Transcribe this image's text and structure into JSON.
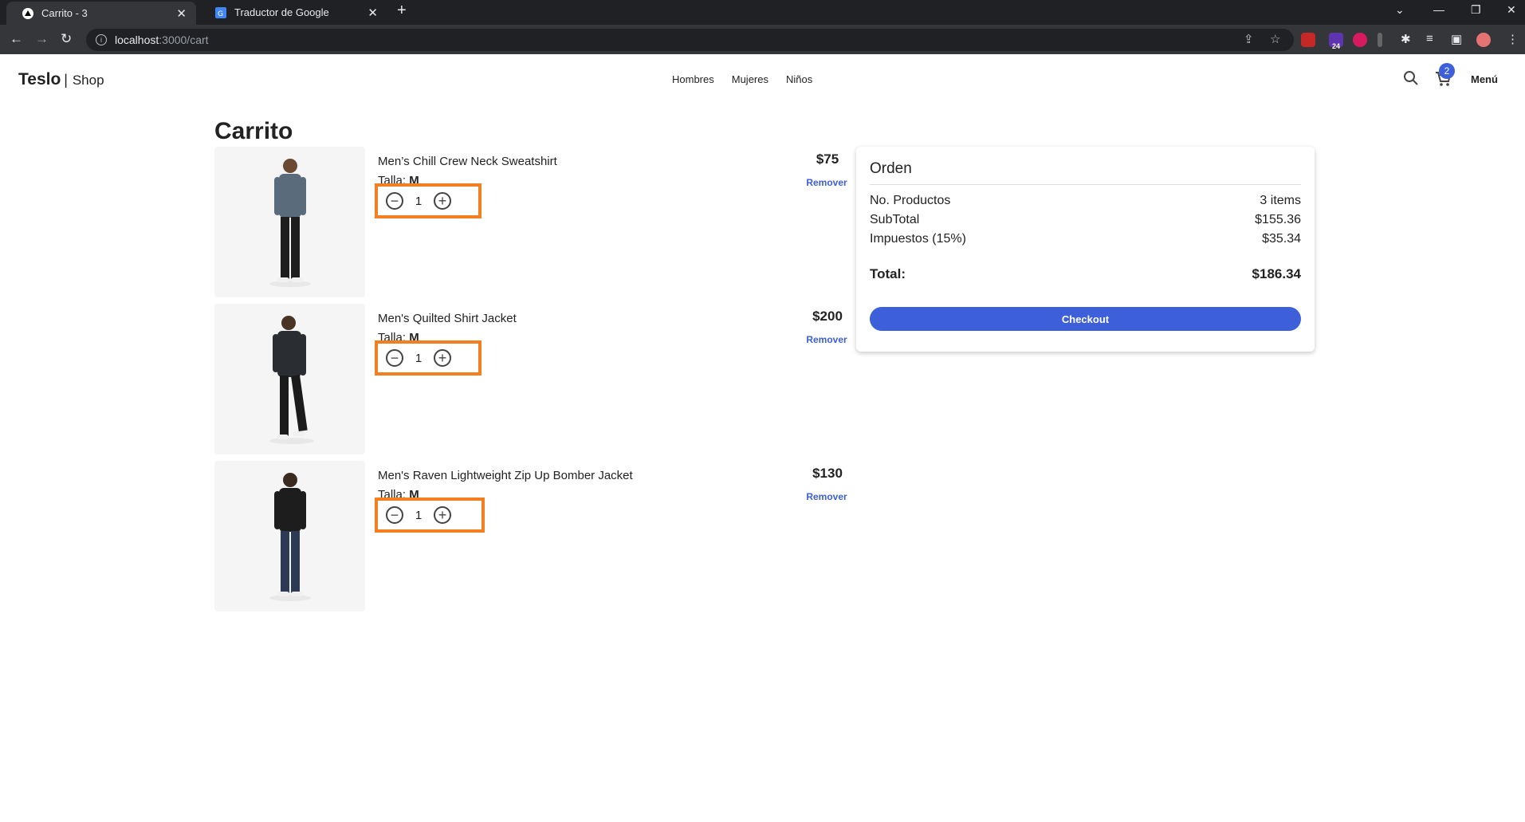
{
  "browser": {
    "tabs": [
      {
        "title": "Carrito - 3",
        "active": true
      },
      {
        "title": "Traductor de Google",
        "active": false
      }
    ],
    "url_host": "localhost",
    "url_path": ":3000/cart",
    "extension_badge": "24"
  },
  "navbar": {
    "brand": "Teslo",
    "separator": "|",
    "brand_sub": "Shop",
    "links": [
      "Hombres",
      "Mujeres",
      "Niños"
    ],
    "cart_count": "2",
    "menu_label": "Menú"
  },
  "page": {
    "title": "Carrito"
  },
  "cart": {
    "size_label": "Talla:",
    "remove_label": "Remover",
    "items": [
      {
        "name": "Men’s Chill Crew Neck Sweatshirt",
        "size": "M",
        "quantity": "1",
        "price": "$75",
        "shirt_color": "#5a6b7b",
        "pants_color": "#1e1e1e"
      },
      {
        "name": "Men's Quilted Shirt Jacket",
        "size": "M",
        "quantity": "1",
        "price": "$200",
        "shirt_color": "#2a2d31",
        "pants_color": "#1b1b1b"
      },
      {
        "name": "Men's Raven Lightweight Zip Up Bomber Jacket",
        "size": "M",
        "quantity": "1",
        "price": "$130",
        "shirt_color": "#1d1d1d",
        "pants_color": "#2c3a55"
      }
    ]
  },
  "order": {
    "title": "Orden",
    "rows": [
      {
        "label": "No. Productos",
        "value": "3 items"
      },
      {
        "label": "SubTotal",
        "value": "$155.36"
      },
      {
        "label": "Impuestos (15%)",
        "value": "$35.34"
      }
    ],
    "total_label": "Total:",
    "total_value": "$186.34",
    "checkout_label": "Checkout"
  },
  "colors": {
    "accent": "#3d5fd9",
    "highlight_box": "#f47f20"
  }
}
